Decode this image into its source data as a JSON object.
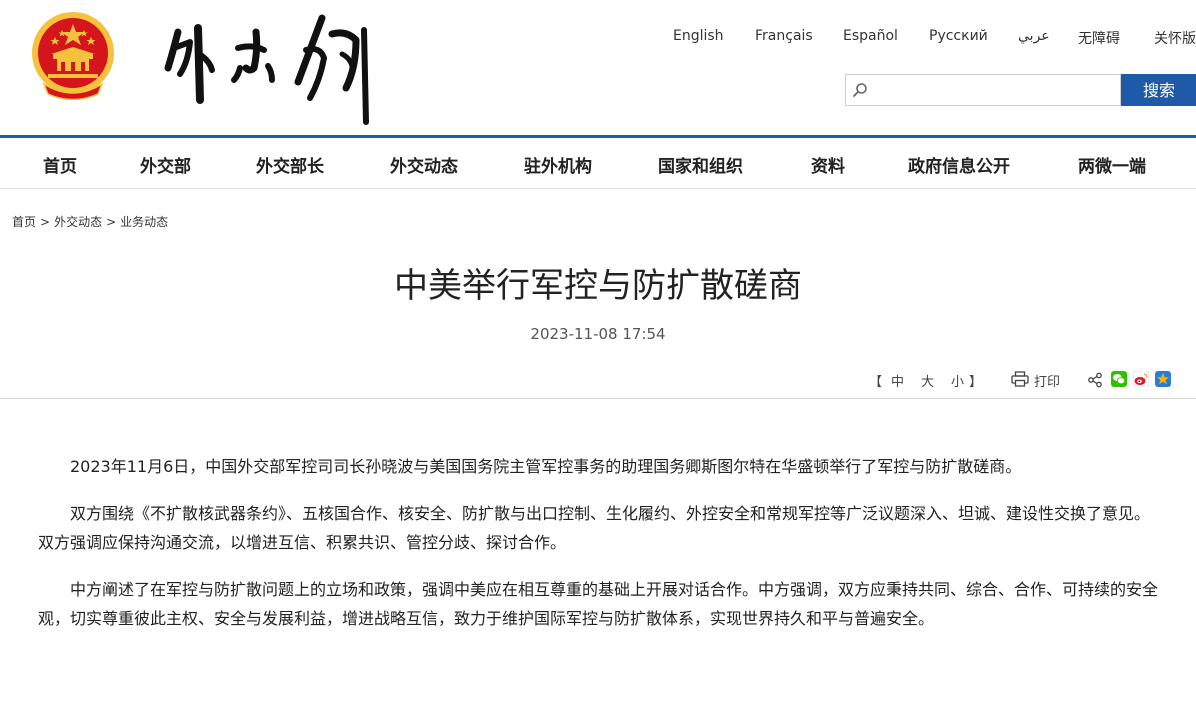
{
  "header": {
    "emblem_name": "national-emblem",
    "calligraphy_name": "ministry-calligraphy-logo",
    "languages": [
      "English",
      "Français",
      "Español",
      "Русский",
      "عربي",
      "无障碍",
      "关怀版"
    ],
    "search": {
      "placeholder": "",
      "value": "",
      "button_label": "搜索"
    }
  },
  "nav": {
    "items": [
      "首页",
      "外交部",
      "外交部长",
      "外交动态",
      "驻外机构",
      "国家和组织",
      "资料",
      "政府信息公开",
      "两微一端"
    ]
  },
  "breadcrumb": {
    "items": [
      "首页",
      "外交动态",
      "业务动态"
    ],
    "separator": ">"
  },
  "article": {
    "title": "中美举行军控与防扩散磋商",
    "date": "2023-11-08 17:54",
    "font_size": {
      "open_bracket": "【",
      "medium": "中",
      "large": "大",
      "small": "小",
      "close_bracket": "】"
    },
    "print_label": "打印",
    "share_icons": [
      "share-icon",
      "wechat-icon",
      "weibo-icon",
      "qzone-icon"
    ],
    "paragraphs": [
      "2023年11月6日，中国外交部军控司司长孙晓波与美国国务院主管军控事务的助理国务卿斯图尔特在华盛顿举行了军控与防扩散磋商。",
      "双方围绕《不扩散核武器条约》、五核国合作、核安全、防扩散与出口控制、生化履约、外控安全和常规军控等广泛议题深入、坦诚、建设性交换了意见。双方强调应保持沟通交流，以增进互信、积累共识、管控分歧、探讨合作。",
      "中方阐述了在军控与防扩散问题上的立场和政策，强调中美应在相互尊重的基础上开展对话合作。中方强调，双方应秉持共同、综合、合作、可持续的安全观，切实尊重彼此主权、安全与发展利益，增进战略互信，致力于维护国际军控与防扩散体系，实现世界持久和平与普遍安全。"
    ]
  },
  "colors": {
    "brand_blue": "#1f5aa8",
    "emblem_red": "#d4161c",
    "emblem_gold": "#f6c23e",
    "wechat_green": "#2dc100",
    "weibo_red": "#e6162d",
    "qzone_yellow": "#f5b400"
  }
}
